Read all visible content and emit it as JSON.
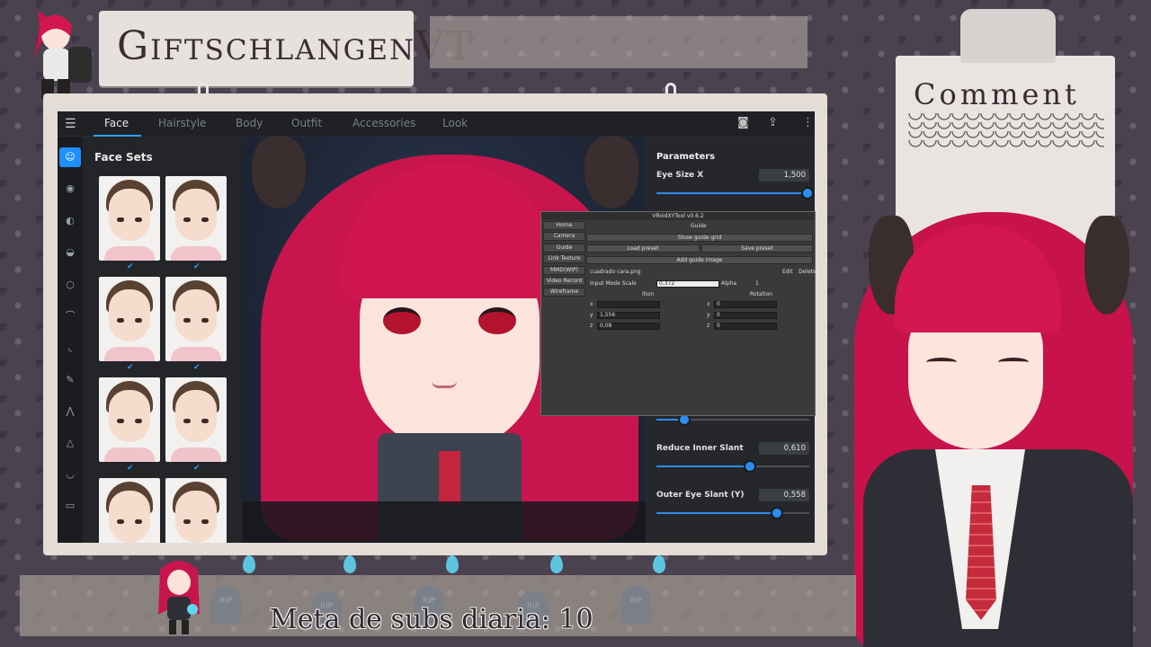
{
  "overlay": {
    "streamer_name": "GiftschlangenVT",
    "comment_title": "Comment",
    "sub_goal": "Meta de subs diaria: 10",
    "tombstone_label": "RIP"
  },
  "app": {
    "menu_icon": "☰",
    "tabs": [
      "Face",
      "Hairstyle",
      "Body",
      "Outfit",
      "Accessories",
      "Look"
    ],
    "active_tab": "Face",
    "top_icons": [
      "camera-icon",
      "export-icon",
      "more-icon"
    ],
    "top_icon_glyphs": [
      "◙",
      "⇪",
      "⋮"
    ],
    "rail_icons": [
      {
        "name": "face-set-icon",
        "glyph": "☺"
      },
      {
        "name": "eye-icon",
        "glyph": "◉"
      },
      {
        "name": "ear-icon",
        "glyph": "◐"
      },
      {
        "name": "nose-icon",
        "glyph": "◒"
      },
      {
        "name": "mouth-icon",
        "glyph": "○"
      },
      {
        "name": "eyebrow-icon",
        "glyph": "⌒"
      },
      {
        "name": "jaw-icon",
        "glyph": "◟"
      },
      {
        "name": "brush-icon",
        "glyph": "✎"
      },
      {
        "name": "lash-icon",
        "glyph": "⋀"
      },
      {
        "name": "cone-icon",
        "glyph": "△"
      },
      {
        "name": "chin-icon",
        "glyph": "◡"
      },
      {
        "name": "eyeliner-icon",
        "glyph": "▭"
      }
    ],
    "face_sets": {
      "title": "Face Sets",
      "check_glyph": "✔"
    },
    "parameters": {
      "title": "Parameters",
      "items": [
        {
          "label": "Eye Size X",
          "value": "1,500",
          "level": 0.99
        },
        {
          "label": "",
          "value": "",
          "level": 0.18
        },
        {
          "label": "Reduce Inner Slant",
          "value": "0,610",
          "level": 0.61
        },
        {
          "label": "Outer Eye Slant (Y)",
          "value": "0,558",
          "level": 0.79
        }
      ]
    }
  },
  "dialog": {
    "title": "VRoidXYTool v0.6.2",
    "sidebar": [
      "Home",
      "Camera",
      "Guide",
      "Link Texture",
      "MMD(WIP)",
      "Video Record",
      "Wireframe"
    ],
    "section": "Guide",
    "show_guide_grid": "Show guide grid",
    "load_preset": "Load preset",
    "save_preset": "Save preset",
    "add_guide_image": "Add guide image",
    "file_name": "cuadrado cara.png",
    "edit": "Edit",
    "delete": "Delete",
    "input_mode_scale": "Input Mode Scale",
    "scale_value": "0,372",
    "alpha_label": "Alpha",
    "alpha_value": "1",
    "position_label": "ition",
    "rotation_label": "Rotation",
    "pos": {
      "x": "",
      "y": "1,556",
      "z": "0,08"
    },
    "rot": {
      "x": "0",
      "y": "0",
      "z": "0"
    }
  },
  "colors": {
    "accent": "#1e8fff",
    "slider": "#2d8cf0",
    "hair": "#c8154d"
  }
}
